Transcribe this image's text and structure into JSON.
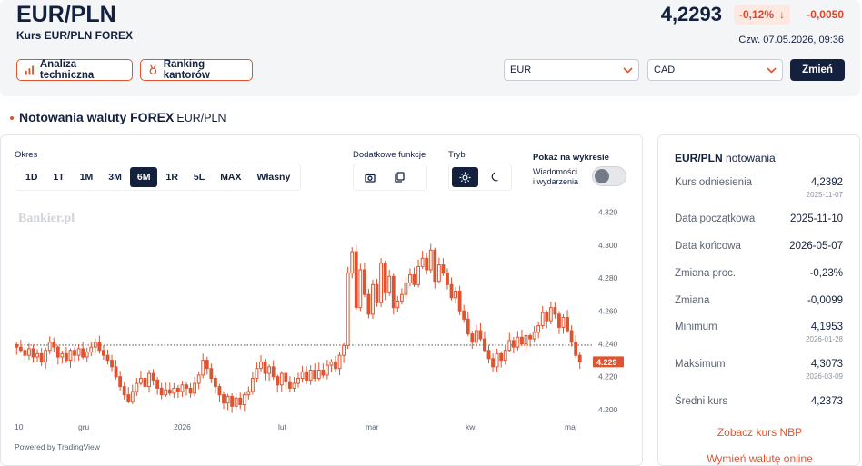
{
  "header": {
    "pair": "EUR/PLN",
    "subtitle": "Kurs EUR/PLN FOREX",
    "price": "4,2293",
    "change_pct": "-0,12%",
    "change_abs": "-0,0050",
    "timestamp": "Czw. 07.05.2026, 09:36",
    "btn_analysis": "Analiza techniczna",
    "btn_ranking": "Ranking kantorów",
    "select_from": "EUR",
    "select_to": "CAD",
    "btn_change": "Zmień"
  },
  "section": {
    "title": "Notowania waluty FOREX",
    "sub": "EUR/PLN"
  },
  "controls": {
    "okres_label": "Okres",
    "ranges": [
      "1D",
      "1T",
      "1M",
      "3M",
      "6M",
      "1R",
      "5L",
      "MAX",
      "Własny"
    ],
    "active_range": "6M",
    "extra_label": "Dodatkowe funkcje",
    "mode_label": "Tryb",
    "show_label": "Pokaż na wykresie",
    "news_label_1": "Wiadomości",
    "news_label_2": "i wydarzenia"
  },
  "chart_data": {
    "type": "candlestick",
    "watermark": "Bankier.pl",
    "credit": "Powered by TradingView",
    "x_ticks": [
      "10",
      "gru",
      "2026",
      "lut",
      "mar",
      "kwi",
      "maj"
    ],
    "y_ticks": [
      "4.320",
      "4.300",
      "4.280",
      "4.260",
      "4.240",
      "4.220",
      "4.200"
    ],
    "ylim": [
      4.195,
      4.322
    ],
    "reference_line": 4.2392,
    "last_price_label": "4.229",
    "up_color": "#e0532f",
    "down_color": "#e0532f",
    "closes": [
      4.238,
      4.236,
      4.233,
      4.237,
      4.232,
      4.234,
      4.229,
      4.236,
      4.241,
      4.238,
      4.232,
      4.234,
      4.23,
      4.236,
      4.233,
      4.237,
      4.232,
      4.235,
      4.238,
      4.241,
      4.236,
      4.233,
      4.23,
      4.226,
      4.22,
      4.214,
      4.209,
      4.205,
      4.211,
      4.216,
      4.219,
      4.214,
      4.222,
      4.218,
      4.213,
      4.209,
      4.212,
      4.21,
      4.213,
      4.211,
      4.215,
      4.213,
      4.21,
      4.216,
      4.221,
      4.23,
      4.225,
      4.219,
      4.214,
      4.209,
      4.204,
      4.208,
      4.202,
      4.207,
      4.203,
      4.209,
      4.211,
      4.219,
      4.225,
      4.229,
      4.222,
      4.226,
      4.22,
      4.215,
      4.222,
      4.217,
      4.213,
      4.216,
      4.219,
      4.223,
      4.218,
      4.224,
      4.219,
      4.224,
      4.221,
      4.227,
      4.229,
      4.225,
      4.233,
      4.239,
      4.283,
      4.296,
      4.262,
      4.285,
      4.27,
      4.258,
      4.276,
      4.265,
      4.289,
      4.271,
      4.281,
      4.262,
      4.266,
      4.27,
      4.277,
      4.282,
      4.276,
      4.287,
      4.292,
      4.285,
      4.297,
      4.278,
      4.288,
      4.283,
      4.276,
      4.268,
      4.272,
      4.26,
      4.255,
      4.246,
      4.241,
      4.248,
      4.243,
      4.236,
      4.231,
      4.226,
      4.234,
      4.23,
      4.236,
      4.242,
      4.238,
      4.244,
      4.24,
      4.245,
      4.243,
      4.247,
      4.251,
      4.259,
      4.254,
      4.262,
      4.258,
      4.25,
      4.256,
      4.248,
      4.241,
      4.233,
      4.229
    ]
  },
  "panel": {
    "title_bold": "EUR/PLN",
    "title_rest": "notowania",
    "rows": [
      {
        "k": "Kurs odniesienia",
        "v": "4,2392",
        "d": "2025-11-07"
      },
      {
        "k": "Data początkowa",
        "v": "2025-11-10",
        "d": ""
      },
      {
        "k": "Data końcowa",
        "v": "2026-05-07",
        "d": ""
      },
      {
        "k": "Zmiana proc.",
        "v": "-0,23%",
        "d": ""
      },
      {
        "k": "Zmiana",
        "v": "-0,0099",
        "d": ""
      },
      {
        "k": "Minimum",
        "v": "4,1953",
        "d": "2026-01-28"
      },
      {
        "k": "Maksimum",
        "v": "4,3073",
        "d": "2026-03-09"
      },
      {
        "k": "Średni kurs",
        "v": "4,2373",
        "d": ""
      }
    ],
    "link_nbp": "Zobacz kurs NBP",
    "link_exchange": "Wymień walutę online"
  },
  "colors": {
    "accent": "#e0532f",
    "navy": "#13213f"
  }
}
